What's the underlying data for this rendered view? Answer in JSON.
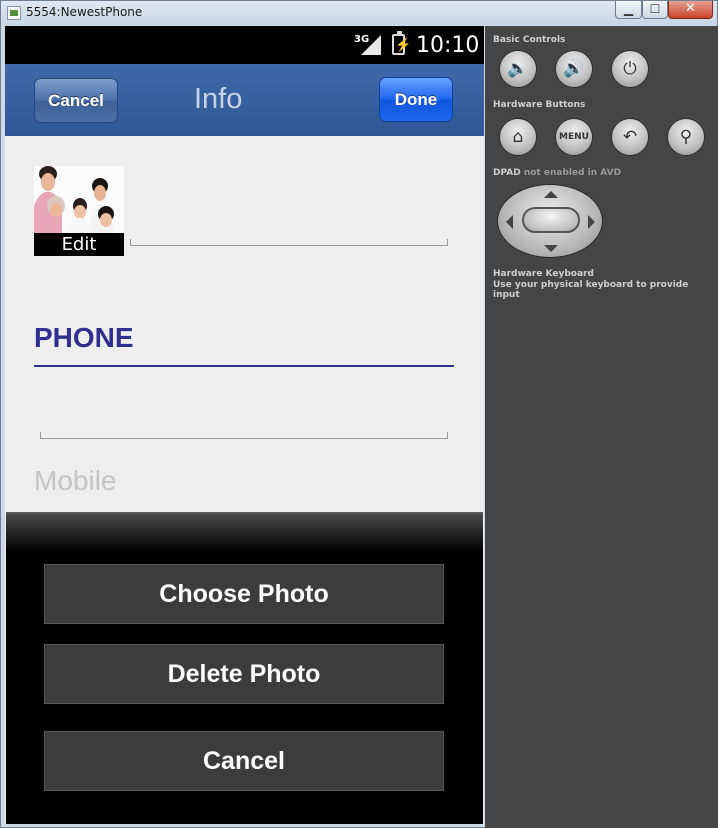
{
  "window": {
    "title": "5554:NewestPhone",
    "minimize_glyph": "▁",
    "maximize_glyph": "☐",
    "close_glyph": "✕"
  },
  "status_bar": {
    "network": "3G",
    "time": "10:10",
    "battery_glyph": "⚡"
  },
  "header": {
    "cancel_label": "Cancel",
    "title": "Info",
    "done_label": "Done"
  },
  "photo": {
    "edit_label": "Edit"
  },
  "phone_section": {
    "title": "PHONE",
    "field_label": "Mobile"
  },
  "action_sheet": {
    "choose_photo": "Choose Photo",
    "delete_photo": "Delete Photo",
    "cancel": "Cancel"
  },
  "emulator_panel": {
    "basic_controls": "Basic Controls",
    "hardware_buttons": "Hardware Buttons",
    "dpad_title": "DPAD",
    "dpad_note": "not enabled in AVD",
    "keyboard_title": "Hardware Keyboard",
    "keyboard_note": "Use your physical keyboard to provide input",
    "volume_down_glyph": "🔈",
    "volume_up_glyph": "🔊",
    "power_glyph": "⏻",
    "home_glyph": "⌂",
    "menu_label": "MENU",
    "back_glyph": "↶",
    "search_glyph": "⚲"
  },
  "colors": {
    "header_blue": "#3a63a3",
    "done_blue": "#1d64ec",
    "section_blue": "#2e2f8e",
    "sheet_button": "#3c3c3c",
    "panel_gray": "#454545"
  }
}
